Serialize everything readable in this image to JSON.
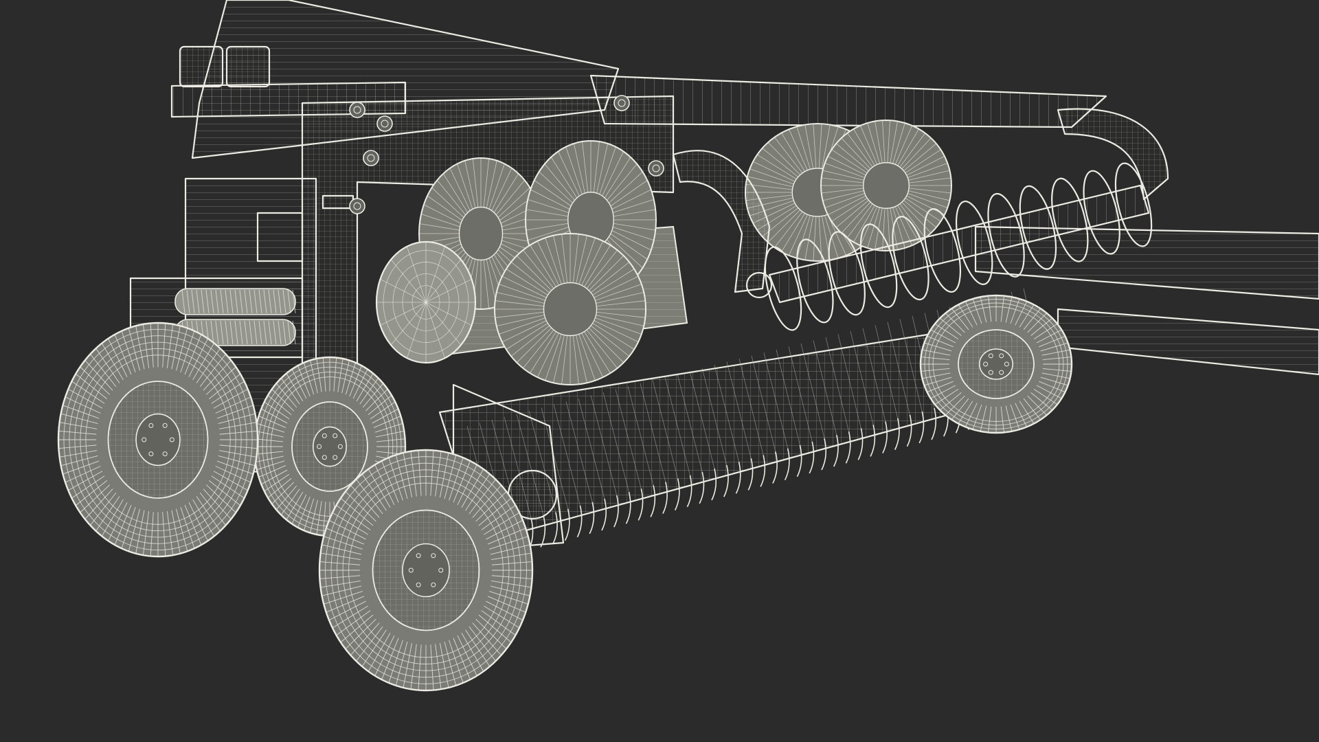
{
  "scene": {
    "subject": "baler-wireframe",
    "colors": {
      "background": "#2b2b2b",
      "body_fill": "#7c7d75",
      "body_fill_dark": "#62635d",
      "body_fill_light": "#94958c",
      "wire": "#ecece4",
      "wire_soft": "#c9c9c0",
      "tire_fill": "#7a7b74",
      "hub_fill": "#6d6e67"
    }
  }
}
